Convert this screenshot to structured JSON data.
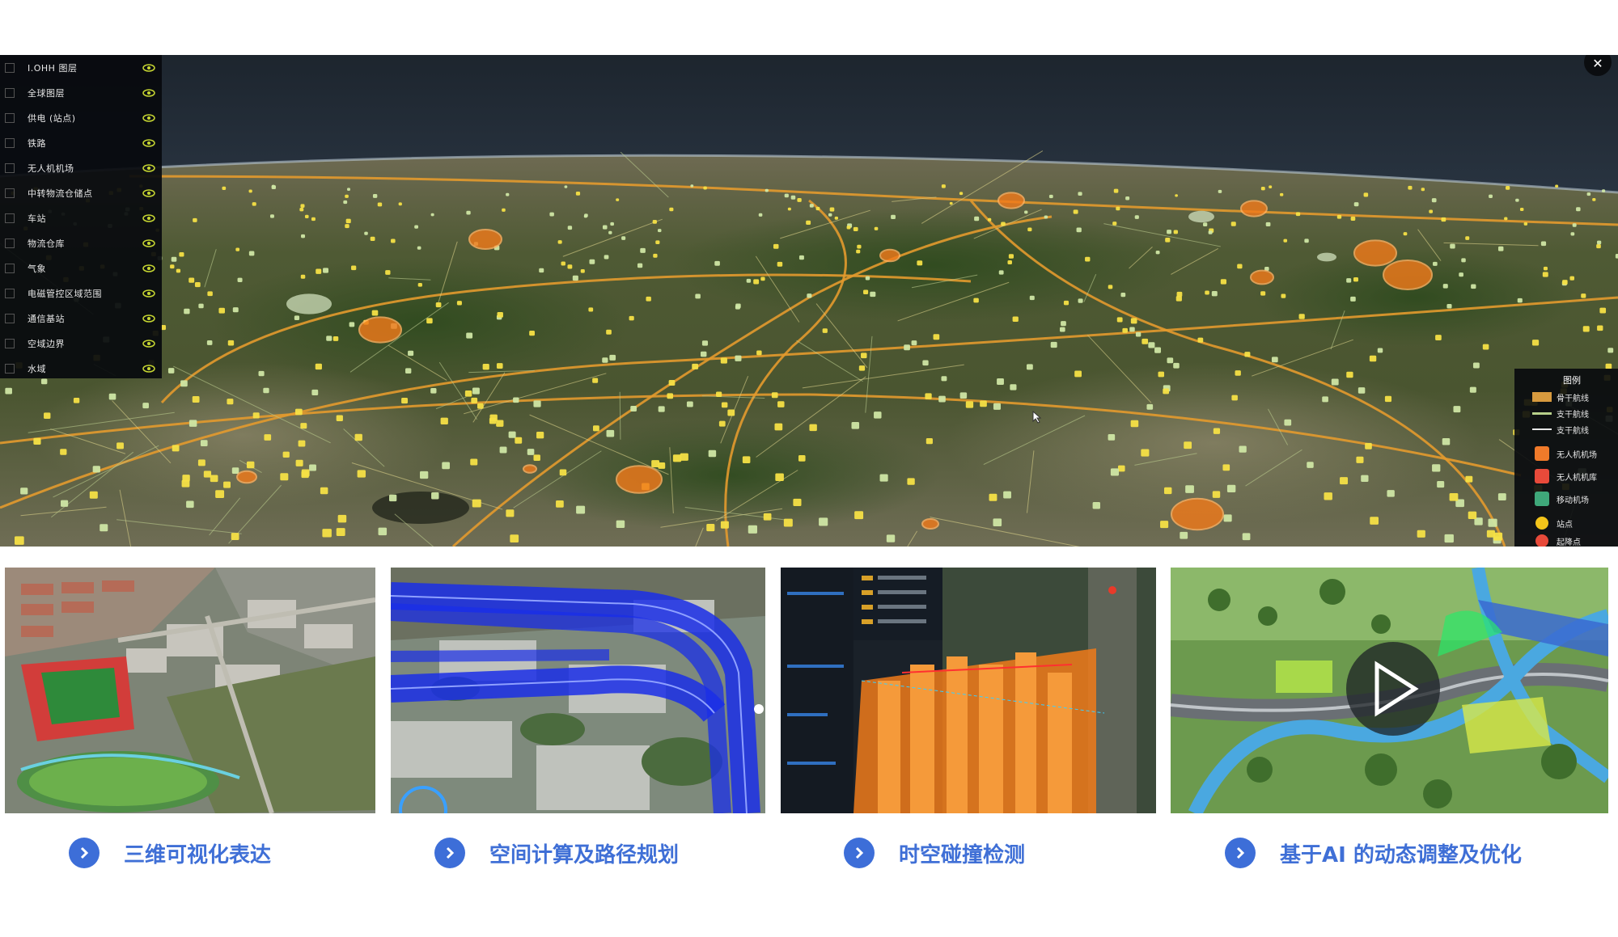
{
  "layer_panel": {
    "items": [
      {
        "label": "I.OHH 图层"
      },
      {
        "label": "全球图层"
      },
      {
        "label": "供电 (站点)"
      },
      {
        "label": "铁路"
      },
      {
        "label": "无人机机场"
      },
      {
        "label": "中转物流仓储点"
      },
      {
        "label": "车站"
      },
      {
        "label": "物流仓库"
      },
      {
        "label": "气象"
      },
      {
        "label": "电磁管控区域范围"
      },
      {
        "label": "通信基站"
      },
      {
        "label": "空域边界"
      },
      {
        "label": "水域"
      }
    ]
  },
  "legend": {
    "title": "图例",
    "items": [
      {
        "label": "骨干航线",
        "color": "#d79a3e"
      },
      {
        "label": "支干航线",
        "color": "#b8d08a"
      },
      {
        "label": "支干航线",
        "color": "#e8e8e8"
      },
      {
        "label": "无人机机场",
        "color": "#f07a2a"
      },
      {
        "label": "无人机机库",
        "color": "#e84a3a"
      },
      {
        "label": "移动机场",
        "color": "#3fa87a"
      },
      {
        "label": "站点",
        "color": "#f3c41a"
      },
      {
        "label": "起降点",
        "color": "#e84a3a"
      }
    ]
  },
  "close_button": {
    "symbol": "✕"
  },
  "features": [
    {
      "caption": "三维可视化表达"
    },
    {
      "caption": "空间计算及路径规划"
    },
    {
      "caption": "时空碰撞检测"
    },
    {
      "caption": "基于AI 的动态调整及优化"
    }
  ],
  "colors": {
    "accent_blue": "#3f6fd6",
    "route_orange": "#e39a2e",
    "node_yellow": "#f6e046",
    "node_green": "#cfe6a4"
  }
}
